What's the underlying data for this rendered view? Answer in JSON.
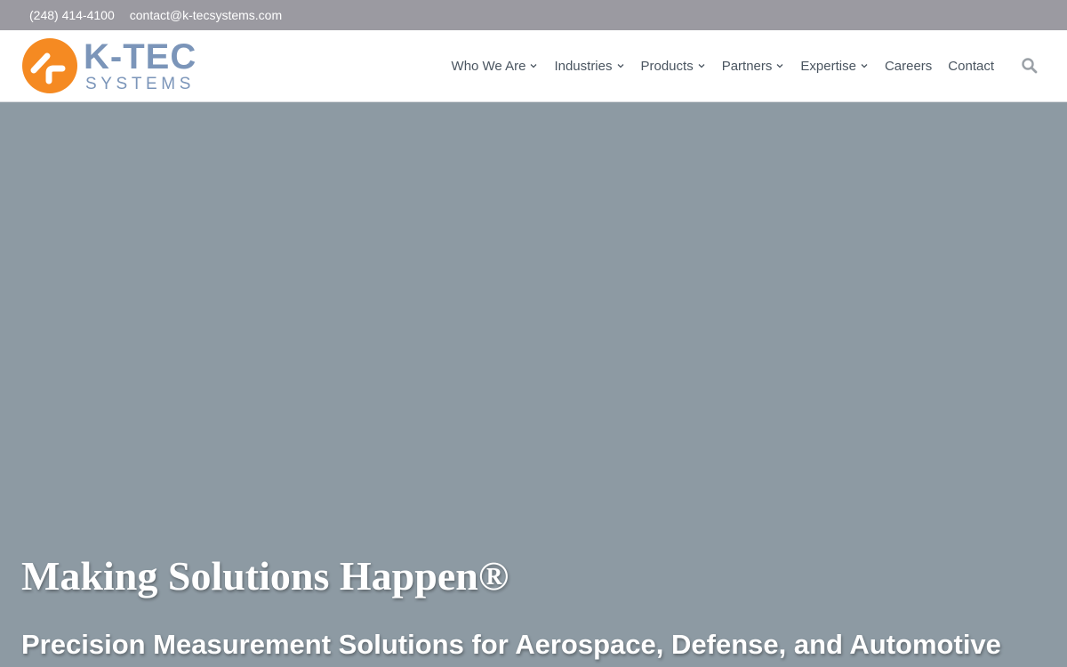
{
  "topbar": {
    "phone": "(248) 414-4100",
    "email": "contact@k-tecsystems.com"
  },
  "logo": {
    "name_line1": "K-TEC",
    "name_line2": "SYSTEMS",
    "mark_icon": "k-tec-logo-mark-icon",
    "colors": {
      "orange": "#f58a22",
      "blue": "#7b95b9"
    }
  },
  "nav": {
    "items": [
      {
        "label": "Who We Are",
        "has_dropdown": true
      },
      {
        "label": "Industries",
        "has_dropdown": true
      },
      {
        "label": "Products",
        "has_dropdown": true
      },
      {
        "label": "Partners",
        "has_dropdown": true
      },
      {
        "label": "Expertise",
        "has_dropdown": true
      },
      {
        "label": "Careers",
        "has_dropdown": false
      },
      {
        "label": "Contact",
        "has_dropdown": false
      }
    ],
    "search_icon": "search-icon"
  },
  "hero": {
    "title": "Making Solutions Happen®",
    "subtitle": "Precision Measurement Solutions for Aerospace, Defense, and Automotive",
    "background_color": "#8d9aa3"
  }
}
